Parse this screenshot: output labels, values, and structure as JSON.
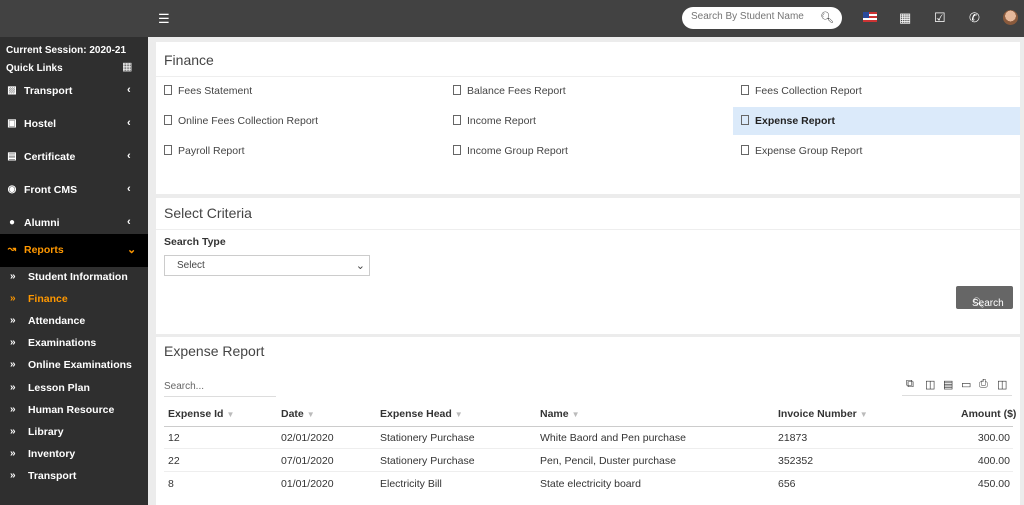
{
  "topbar": {
    "search_placeholder": "Search By Student Name"
  },
  "sidebar": {
    "session": "Current Session: 2020-21",
    "quick_links": "Quick Links",
    "menu": [
      {
        "label": "Transport",
        "icon": "bus-icon"
      },
      {
        "label": "Hostel",
        "icon": "building-icon"
      },
      {
        "label": "Certificate",
        "icon": "certificate-icon"
      },
      {
        "label": "Front CMS",
        "icon": "globe-icon"
      },
      {
        "label": "Alumni",
        "icon": "alumni-icon"
      },
      {
        "label": "Reports",
        "icon": "chart-line-icon"
      }
    ],
    "submenu": [
      "Student Information",
      "Finance",
      "Attendance",
      "Examinations",
      "Online Examinations",
      "Lesson Plan",
      "Human Resource",
      "Library",
      "Inventory",
      "Transport"
    ]
  },
  "finance": {
    "title": "Finance",
    "links": [
      "Fees Statement",
      "Balance Fees Report",
      "Fees Collection Report",
      "Online Fees Collection Report",
      "Income Report",
      "Expense Report",
      "Payroll Report",
      "Income Group Report",
      "Expense Group Report"
    ]
  },
  "criteria": {
    "title": "Select Criteria",
    "search_type_label": "Search Type",
    "search_type_value": "Select",
    "search_button": "Search"
  },
  "report": {
    "title": "Expense Report",
    "search_placeholder": "Search...",
    "columns": [
      "Expense Id",
      "Date",
      "Expense Head",
      "Name",
      "Invoice Number",
      "Amount ($)"
    ],
    "rows": [
      [
        "12",
        "02/01/2020",
        "Stationery Purchase",
        "White Baord and Pen purchase",
        "21873",
        "300.00"
      ],
      [
        "22",
        "07/01/2020",
        "Stationery Purchase",
        "Pen, Pencil, Duster purchase",
        "352352",
        "400.00"
      ],
      [
        "8",
        "01/01/2020",
        "Electricity Bill",
        "State electricity board",
        "656",
        "450.00"
      ]
    ]
  },
  "colors": {
    "topbar": "#424242",
    "sidebar": "#2f2f2f",
    "accent": "#ff9800",
    "selected_link": "#dbeafa"
  }
}
